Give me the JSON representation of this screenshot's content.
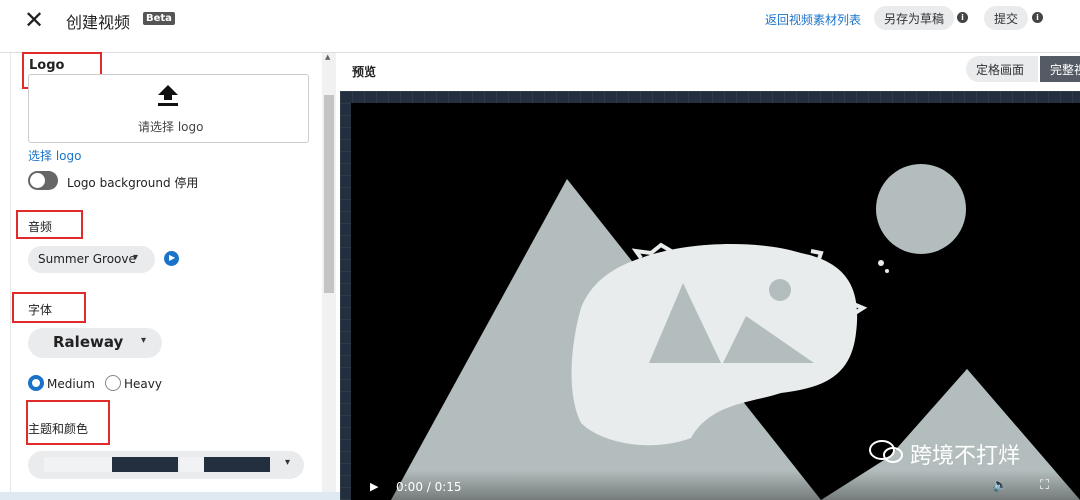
{
  "header": {
    "title": "创建视频",
    "beta": "Beta",
    "back_link": "返回视频素材列表",
    "save_draft": "另存为草稿",
    "submit": "提交",
    "info_glyph": "i"
  },
  "sidebar": {
    "logo": {
      "section_label": "Logo",
      "upload_text": "请选择 logo",
      "select_link": "选择 logo",
      "background_toggle_label": "Logo background 停用",
      "background_enabled": false
    },
    "audio": {
      "section_label": "音频",
      "selected_track": "Summer Groove"
    },
    "font": {
      "section_label": "字体",
      "selected_font": "Raleway",
      "weights": [
        "Medium",
        "Heavy"
      ],
      "selected_weight": "Medium"
    },
    "theme": {
      "section_label": "主题和颜色",
      "colors": [
        "#f0f2f4",
        "#232f3e",
        "#f0f2f4",
        "#232f3e"
      ]
    }
  },
  "preview": {
    "label": "预览",
    "modes": [
      "定格画面",
      "完整视"
    ],
    "selected_mode": "完整视",
    "time": "0:00 / 0:15",
    "watermark": "跨境不打烊"
  },
  "colors": {
    "accent": "#1a73c9",
    "highlight_box": "#e12b2b",
    "stage_bg": "#232f3e",
    "placeholder_shape": "#b3bdbd"
  },
  "icons": {
    "close": "close-icon",
    "upload": "upload-icon",
    "chevron": "chevron-down-icon",
    "play": "play-icon",
    "volume": "volume-icon",
    "fullscreen": "fullscreen-icon"
  }
}
